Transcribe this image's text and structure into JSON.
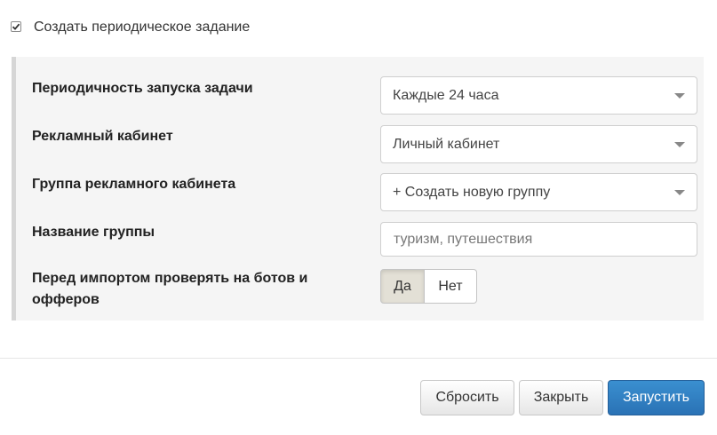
{
  "periodic": {
    "label": "Создать периодическое задание",
    "checked": true
  },
  "form": {
    "frequency": {
      "label": "Периодичность запуска задачи",
      "value": "Каждые 24 часа"
    },
    "ad_account": {
      "label": "Рекламный кабинет",
      "value": "Личный кабинет"
    },
    "account_group": {
      "label": "Группа рекламного кабинета",
      "value": "+ Создать новую группу"
    },
    "group_name": {
      "label": "Название группы",
      "placeholder": "туризм, путешествия",
      "value": ""
    },
    "bot_check": {
      "label_line1": "Перед импортом проверять на ботов и",
      "label_line2": "офферов",
      "yes_label": "Да",
      "no_label": "Нет",
      "selected": "yes"
    }
  },
  "footer": {
    "reset_label": "Сбросить",
    "close_label": "Закрыть",
    "run_label": "Запустить"
  },
  "colors": {
    "primary": "#2a72b5",
    "panel_bg": "#f5f5f5",
    "panel_border": "#d6d6d6"
  }
}
